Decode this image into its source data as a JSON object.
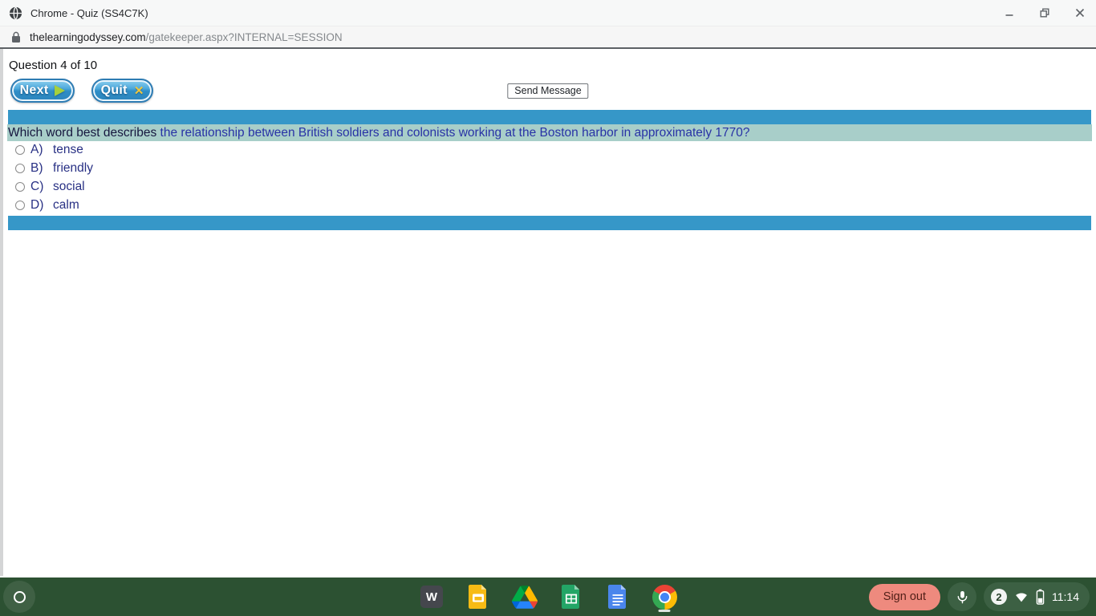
{
  "titlebar": {
    "title": "Chrome - Quiz (SS4C7K)"
  },
  "address_bar": {
    "domain": "thelearningodyssey.com",
    "path": "/gatekeeper.aspx?INTERNAL=SESSION"
  },
  "quiz": {
    "progress_label": "Question 4 of 10",
    "next_button": "Next",
    "quit_button": "Quit",
    "send_message_button": "Send Message",
    "question_part1": "Which word best describes",
    "question_part2": " the relationship between British soldiers and colonists working at the Boston harbor in approximately 1770?",
    "options": [
      {
        "letter": "A)",
        "text": "tense"
      },
      {
        "letter": "B)",
        "text": "friendly"
      },
      {
        "letter": "C)",
        "text": "social"
      },
      {
        "letter": "D)",
        "text": "calm"
      }
    ]
  },
  "shelf": {
    "sign_out_button": "Sign out",
    "notification_count": "2",
    "time": "11:14",
    "apps": [
      "w-app",
      "google-slides",
      "google-drive",
      "google-sheets",
      "google-docs",
      "chrome"
    ]
  },
  "icons": {
    "quit_x_glyph": "✕",
    "w_app_glyph": "W"
  },
  "colors": {
    "bar_blue": "#3697c8",
    "highlight_teal": "#a8cec9",
    "question_dark": "#16173f",
    "question_blue": "#2832a6",
    "option_text": "#283084",
    "shelf_green": "#2c5132",
    "shelf_pill_green": "#3c6043",
    "signout_bg": "#ee8a7e",
    "signout_text": "#501f17"
  }
}
